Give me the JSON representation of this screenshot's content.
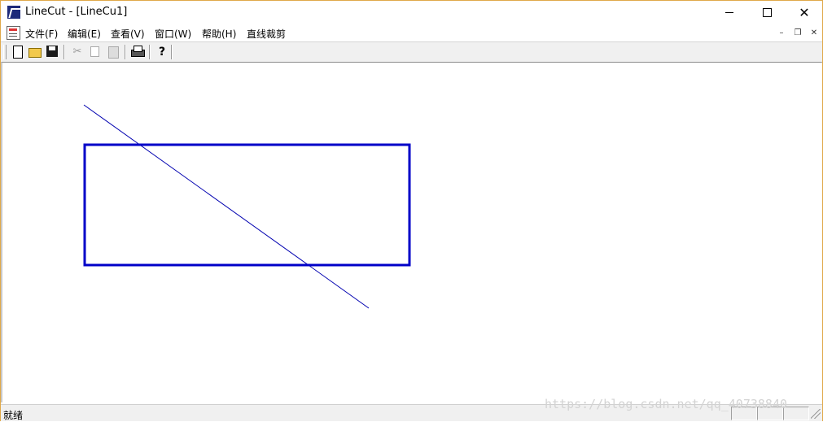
{
  "window": {
    "title": "LineCut - [LineCu1]",
    "icon": "app-icon",
    "controls": {
      "minimize": "minimize",
      "maximize": "maximize",
      "close": "✕"
    }
  },
  "menu": {
    "items": [
      "文件(F)",
      "编辑(E)",
      "查看(V)",
      "窗口(W)",
      "帮助(H)",
      "直线裁剪"
    ],
    "mdi_controls": {
      "minimize": "–",
      "restore": "❐",
      "close": "✕"
    }
  },
  "toolbar": {
    "buttons": [
      "new-file-icon",
      "open-folder-icon",
      "save-icon",
      "cut-icon",
      "copy-icon",
      "paste-icon",
      "print-icon",
      "help-icon"
    ],
    "cut_glyph": "✂",
    "help_glyph": "?"
  },
  "drawing": {
    "line_color": "#0000b0",
    "rect_color": "#0000c8"
  },
  "status": {
    "text": "就绪"
  },
  "watermark": "https://blog.csdn.net/qq_40738840"
}
